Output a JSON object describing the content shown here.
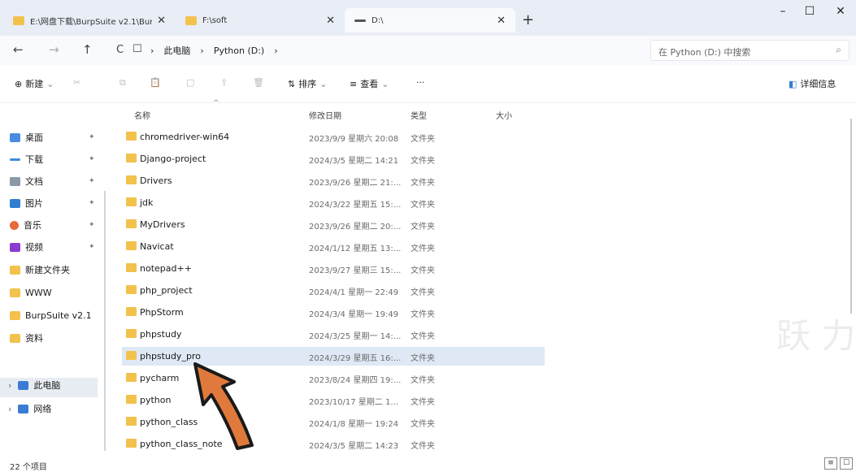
{
  "tabs": [
    {
      "label": "E:\\网盘下载\\BurpSuite v2.1\\Bur",
      "close": "✕"
    },
    {
      "label": "F:\\soft",
      "close": "✕"
    },
    {
      "label": "D:\\",
      "close": "✕"
    }
  ],
  "new_tab": "+",
  "window_controls": {
    "minimize": "–",
    "maximize": "☐",
    "close": "✕"
  },
  "nav": {
    "back": "←",
    "forward": "→",
    "up": "↑",
    "refresh": "C",
    "view": "☐"
  },
  "breadcrumb": {
    "sep1": "›",
    "this_pc": "此电脑",
    "sep2": "›",
    "drive": "Python (D:)",
    "sep3": "›"
  },
  "search": {
    "placeholder": "在 Python (D:) 中搜索",
    "icon": "⌕"
  },
  "toolbar": {
    "new_label": "新建",
    "new_icon": "⊕",
    "sort_label": "排序",
    "sort_icon": "⇅",
    "view_label": "查看",
    "view_icon": "≡",
    "more": "···",
    "details_label": "详细信息",
    "details_icon": "◧",
    "chevron": "⌄",
    "cut": "✂",
    "copy": "⧉",
    "paste": "📋",
    "rename": "▢",
    "share": "⇪",
    "delete": "🗑"
  },
  "columns": {
    "name": "名称",
    "date": "修改日期",
    "type": "类型",
    "size": "大小",
    "sort_caret": "^"
  },
  "sidebar": {
    "quick_access": [
      {
        "label": "桌面",
        "icon": "desktop-icon",
        "pin": "✦",
        "color": "#4a8be0"
      },
      {
        "label": "下载",
        "icon": "download-icon",
        "pin": "✦",
        "color": "#3a8edb"
      },
      {
        "label": "文档",
        "icon": "document-icon",
        "pin": "✦",
        "color": "#8a98a8"
      },
      {
        "label": "图片",
        "icon": "pictures-icon",
        "pin": "✦",
        "color": "#2f7fd0"
      },
      {
        "label": "音乐",
        "icon": "music-icon",
        "pin": "✦",
        "color": "#e86a3a"
      },
      {
        "label": "视频",
        "icon": "video-icon",
        "pin": "✦",
        "color": "#8a3ad0"
      },
      {
        "label": "新建文件夹",
        "icon": "folder-icon",
        "pin": "",
        "color": "#f2c24c"
      },
      {
        "label": "WWW",
        "icon": "folder-icon",
        "pin": "",
        "color": "#f2c24c"
      },
      {
        "label": "BurpSuite v2.1",
        "icon": "folder-icon",
        "pin": "",
        "color": "#f2c24c"
      },
      {
        "label": "资料",
        "icon": "folder-icon",
        "pin": "",
        "color": "#f2c24c"
      }
    ],
    "this_pc": {
      "label": "此电脑",
      "chevron": "›"
    },
    "network": {
      "label": "网络",
      "chevron": "›"
    }
  },
  "files": [
    {
      "name": "chromedriver-win64",
      "date": "2023/9/9 星期六 20:08",
      "type": "文件夹"
    },
    {
      "name": "Django-project",
      "date": "2024/3/5 星期二 14:21",
      "type": "文件夹"
    },
    {
      "name": "Drivers",
      "date": "2023/9/26 星期二 21:...",
      "type": "文件夹"
    },
    {
      "name": "jdk",
      "date": "2024/3/22 星期五 15:...",
      "type": "文件夹"
    },
    {
      "name": "MyDrivers",
      "date": "2023/9/26 星期二 20:...",
      "type": "文件夹"
    },
    {
      "name": "Navicat",
      "date": "2024/1/12 星期五 13:...",
      "type": "文件夹"
    },
    {
      "name": "notepad++",
      "date": "2023/9/27 星期三 15:...",
      "type": "文件夹"
    },
    {
      "name": "php_project",
      "date": "2024/4/1 星期一 22:49",
      "type": "文件夹"
    },
    {
      "name": "PhpStorm",
      "date": "2024/3/4 星期一 19:49",
      "type": "文件夹"
    },
    {
      "name": "phpstudy",
      "date": "2024/3/25 星期一 14:...",
      "type": "文件夹"
    },
    {
      "name": "phpstudy_pro",
      "date": "2024/3/29 星期五 16:...",
      "type": "文件夹"
    },
    {
      "name": "pycharm",
      "date": "2023/8/24 星期四 19:...",
      "type": "文件夹"
    },
    {
      "name": "python",
      "date": "2023/10/17 星期二 1...",
      "type": "文件夹"
    },
    {
      "name": "python_class",
      "date": "2024/1/8 星期一 19:24",
      "type": "文件夹"
    },
    {
      "name": "python_class_note",
      "date": "2024/3/5 星期二 14:23",
      "type": "文件夹"
    }
  ],
  "selected_file": "phpstudy_pro",
  "status": {
    "count": "22 个项目"
  },
  "view_toggle": {
    "details": "≡",
    "tiles": "☐"
  },
  "watermark": "跃 力",
  "colors": {
    "folder": "#f2c24c",
    "selection": "#dfe8f5",
    "arrow": "#e07a3c"
  }
}
